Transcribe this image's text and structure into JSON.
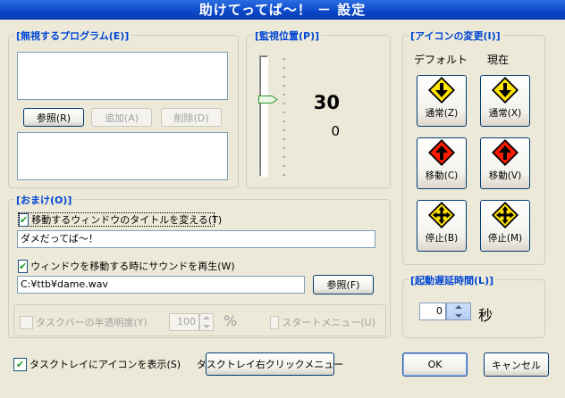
{
  "window": {
    "title": "助けてってば～！ － 設定"
  },
  "ignore": {
    "label": "[無視するプログラム(E)]",
    "browse": "参照(R)",
    "add": "追加(A)",
    "delete": "削除(D)"
  },
  "monitor": {
    "label": "[監視位置(P)]",
    "value": "30",
    "sub_value": "0",
    "slider_fraction": 0.35
  },
  "icons": {
    "label": "[アイコンの変更(I)]",
    "default_header": "デフォルト",
    "current_header": "現在",
    "normal_default": "通常(Z)",
    "normal_current": "通常(X)",
    "move_default": "移動(C)",
    "move_current": "移動(V)",
    "stop_default": "停止(B)",
    "stop_current": "停止(M)",
    "colors": {
      "yellow": "#ffe400",
      "red": "#ff1a00",
      "dark": "#000000"
    }
  },
  "extras": {
    "label": "[おまけ(O)]",
    "change_title_label": "移動するウィンドウのタイトルを変える(T)",
    "change_title_checked": true,
    "title_value": "ダメだってば～！",
    "sound_label": "ウィンドウを移動する時にサウンドを再生(W)",
    "sound_checked": true,
    "sound_path": "C:¥ttb¥dame.wav",
    "sound_browse": "参照(F)",
    "taskbar_label": "タスクバーの半透明度(Y)",
    "taskbar_value": "100",
    "percent": "%",
    "start_menu_label": "スタートメニュー(U)"
  },
  "delay": {
    "label": "[起動遅延時間(L)]",
    "value": "0",
    "unit": "秒"
  },
  "footer": {
    "tray_label": "タスクトレイにアイコンを表示(S)",
    "tray_checked": true,
    "tray_menu": "タスクトレイ右クリックメニュー",
    "ok": "OK",
    "cancel": "キャンセル"
  }
}
